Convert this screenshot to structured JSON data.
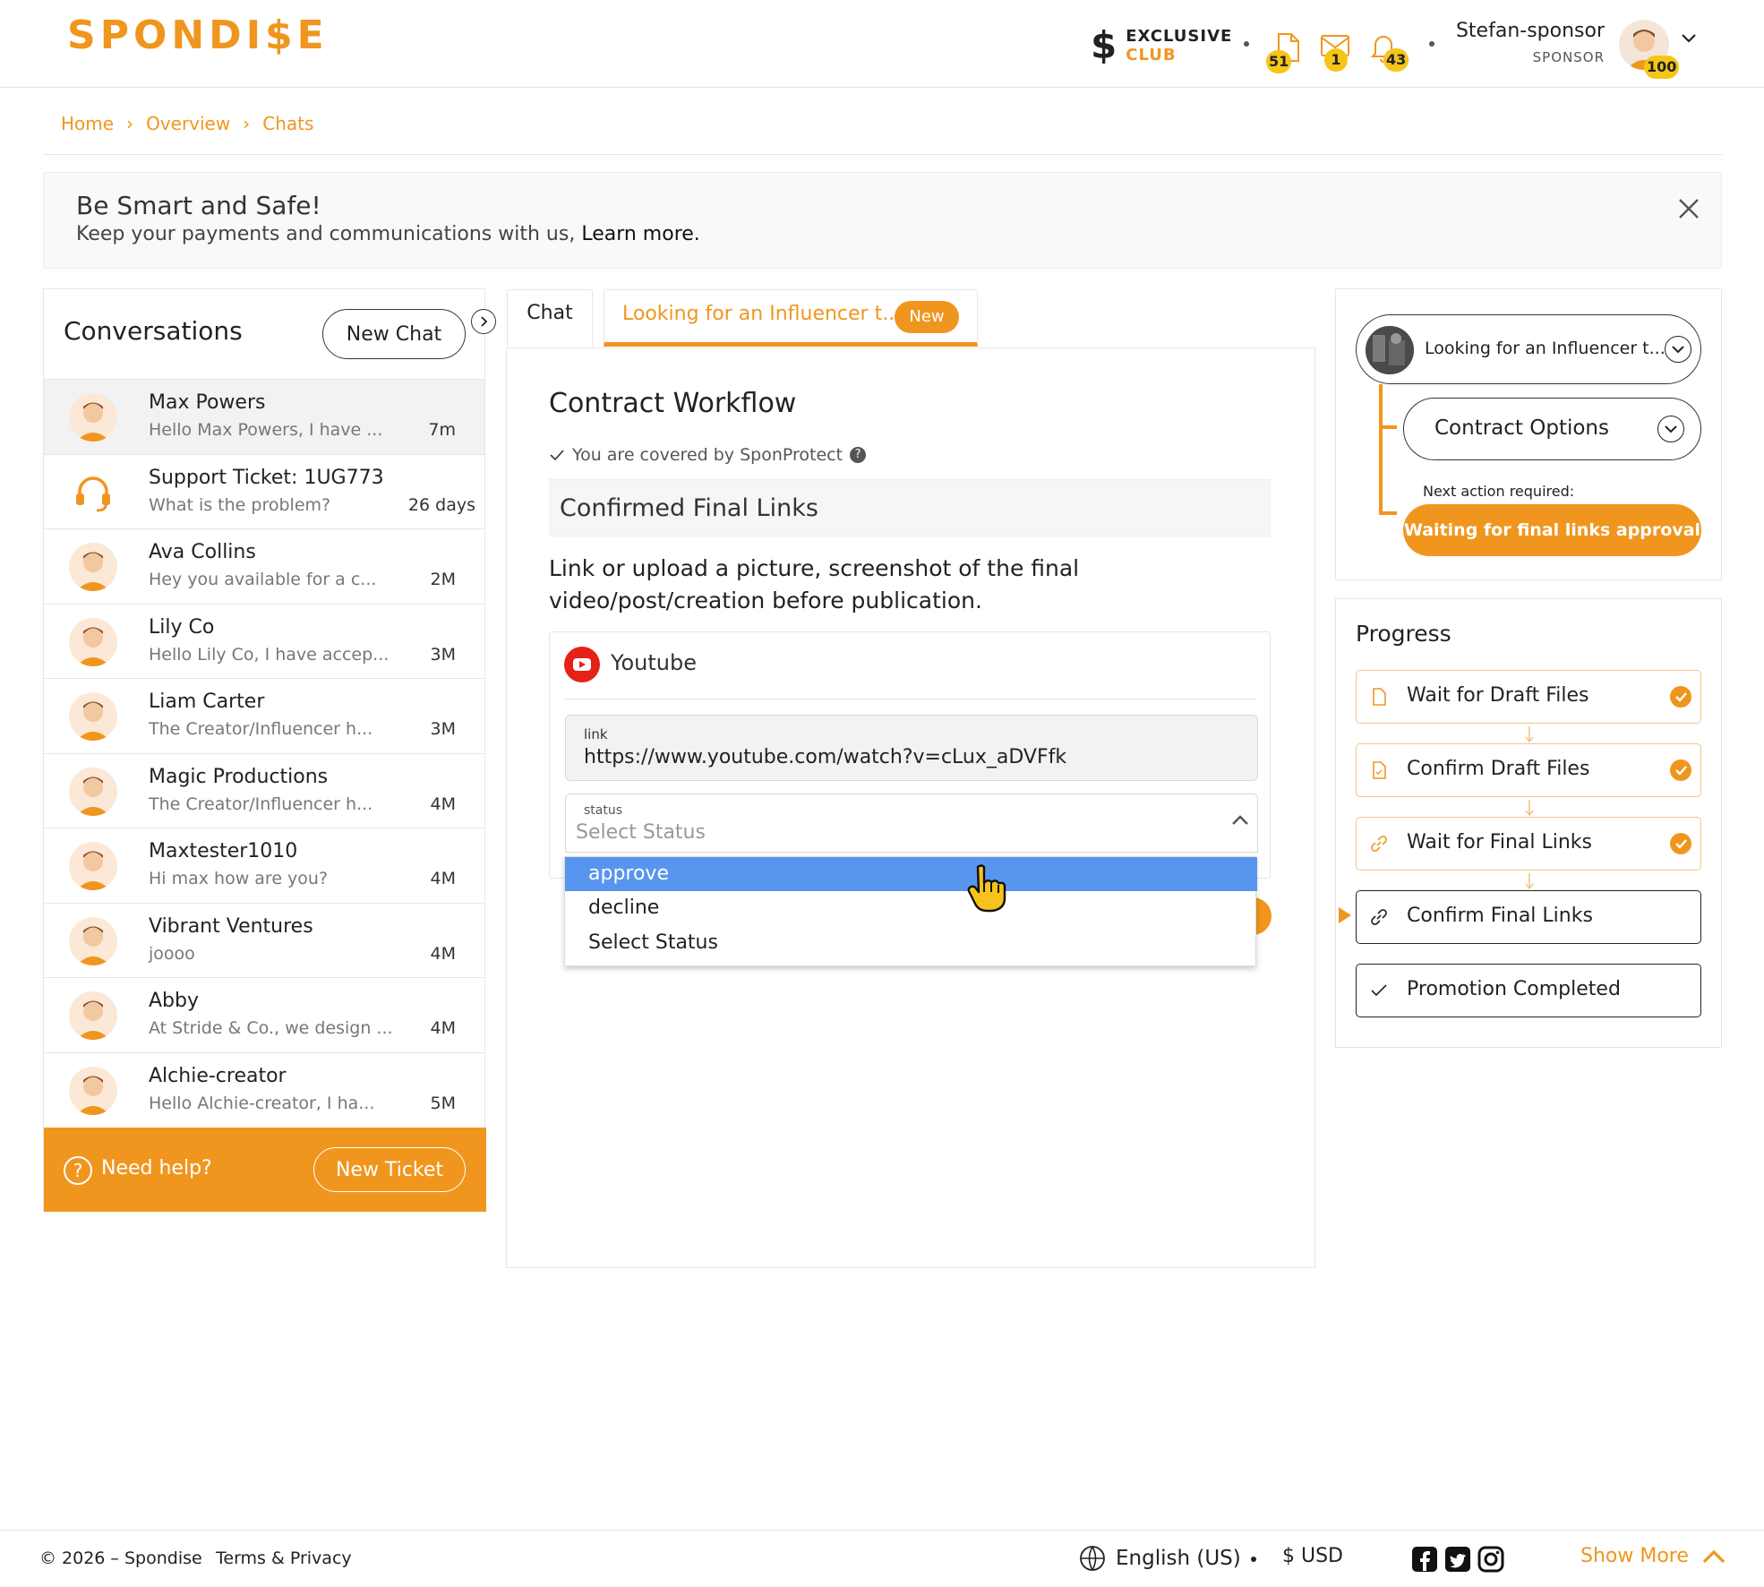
{
  "brand": {
    "logo_text": "SPONDI$E",
    "accent": "#F0961E"
  },
  "header": {
    "club_line1": "EXCLUSIVE",
    "club_line2": "CLUB",
    "badges": {
      "offers": "51",
      "messages": "1",
      "notifications": "43",
      "avatar": "100"
    },
    "user_name": "Stefan-sponsor",
    "user_role": "SPONSOR"
  },
  "breadcrumb": [
    "Home",
    "Overview",
    "Chats"
  ],
  "banner": {
    "title": "Be Smart and Safe!",
    "text": "Keep your payments and communications with us,",
    "link": "Learn more."
  },
  "conversations": {
    "title": "Conversations",
    "new_chat_label": "New Chat",
    "items": [
      {
        "name": "Max Powers",
        "message": "Hello Max Powers, I have ...",
        "time": "7m"
      },
      {
        "name": "Support Ticket: 1UG773",
        "message": "What is the problem?",
        "time": "26 days"
      },
      {
        "name": "Ava Collins",
        "message": "Hey you available for a c...",
        "time": "2M"
      },
      {
        "name": "Lily Co",
        "message": "Hello Lily Co, I have accep...",
        "time": "3M"
      },
      {
        "name": "Liam Carter",
        "message": "The Creator/Influencer h...",
        "time": "3M"
      },
      {
        "name": "Magic Productions",
        "message": "The Creator/Influencer h...",
        "time": "4M"
      },
      {
        "name": "Maxtester1010",
        "message": "Hi max how are you?",
        "time": "4M"
      },
      {
        "name": "Vibrant Ventures",
        "message": "joooo",
        "time": "4M"
      },
      {
        "name": "Abby",
        "message": "At Stride & Co., we design ...",
        "time": "4M"
      },
      {
        "name": "Alchie-creator",
        "message": "Hello Alchie-creator, I ha...",
        "time": "5M"
      }
    ],
    "help_label": "Need help?",
    "new_ticket_label": "New Ticket"
  },
  "tabs": {
    "chat": "Chat",
    "deal": "Looking for an Influencer t...",
    "deal_badge": "New"
  },
  "workflow": {
    "title": "Contract Workflow",
    "covered": "You are covered by SponProtect",
    "step": "Confirmed Final Links",
    "instructions": "Link or upload a picture, screenshot of the final video/post/creation before publication.",
    "platform": "Youtube",
    "link_label": "link",
    "link_value": "https://www.youtube.com/watch?v=cLux_aDVFfk",
    "status_label": "status",
    "status_placeholder": "Select Status",
    "status_options": [
      "approve",
      "decline",
      "Select Status"
    ],
    "highlighted_option": "approve"
  },
  "deal_panel": {
    "deal_label": "Looking for an Influencer t...",
    "contract_options_label": "Contract Options",
    "next_label": "Next action required:",
    "next_action": "Waiting for final links approval"
  },
  "progress": {
    "title": "Progress",
    "steps": [
      {
        "label": "Wait for Draft Files",
        "state": "done"
      },
      {
        "label": "Confirm Draft Files",
        "state": "done"
      },
      {
        "label": "Wait for Final Links",
        "state": "done"
      },
      {
        "label": "Confirm Final Links",
        "state": "current"
      },
      {
        "label": "Promotion Completed",
        "state": "pending"
      }
    ]
  },
  "footer": {
    "copyright": "© 2026 – Spondise",
    "terms": "Terms & Privacy",
    "language": "English (US)",
    "currency": "$ USD",
    "show_more": "Show More"
  }
}
